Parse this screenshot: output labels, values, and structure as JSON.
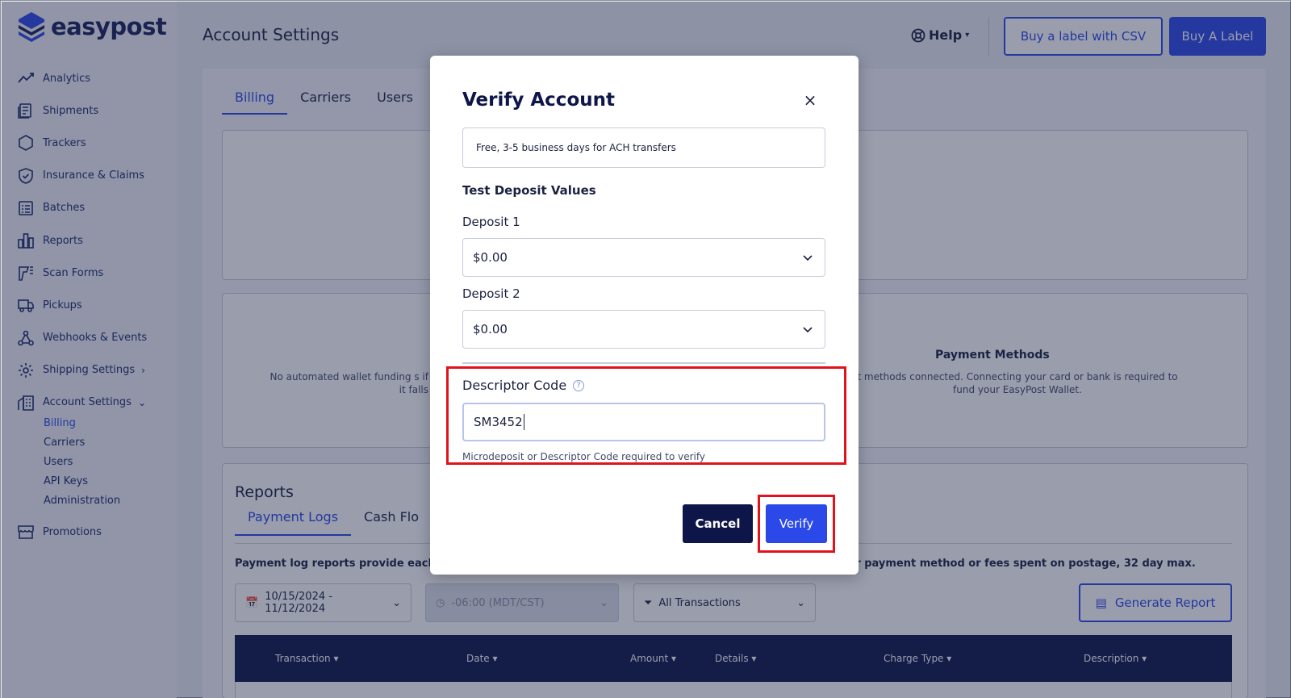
{
  "brand": {
    "name": "easypost",
    "accent": "#2b48e8",
    "navy": "#0d1549",
    "highlight": "#e1121b"
  },
  "sidebar": {
    "items": [
      {
        "label": "Analytics",
        "icon": "analytics-icon"
      },
      {
        "label": "Shipments",
        "icon": "shipments-icon"
      },
      {
        "label": "Trackers",
        "icon": "trackers-icon"
      },
      {
        "label": "Insurance & Claims",
        "icon": "shield-icon"
      },
      {
        "label": "Batches",
        "icon": "batches-icon"
      },
      {
        "label": "Reports",
        "icon": "reports-icon"
      },
      {
        "label": "Scan Forms",
        "icon": "scanner-icon"
      },
      {
        "label": "Pickups",
        "icon": "truck-icon"
      },
      {
        "label": "Webhooks & Events",
        "icon": "webhooks-icon"
      },
      {
        "label": "Shipping Settings",
        "icon": "gear-icon"
      },
      {
        "label": "Account Settings",
        "icon": "account-icon"
      },
      {
        "label": "Promotions",
        "icon": "store-icon"
      }
    ],
    "account_sub": [
      "Billing",
      "Carriers",
      "Users",
      "API Keys",
      "Administration"
    ],
    "shipping_chevron": "›",
    "account_chevron": "⌄"
  },
  "header": {
    "title": "Account Settings",
    "help_label": "Help",
    "buy_csv_label": "Buy a label with CSV",
    "buy_label": "Buy A Label"
  },
  "tabs": [
    "Billing",
    "Carriers",
    "Users"
  ],
  "background": {
    "wallet_text": "No automated wallet funding s if it falls",
    "payment_methods_title": "Payment Methods",
    "payment_methods_text": "t methods connected. Connecting your card or bank is required to fund your EasyPost Wallet.",
    "reports_title": "Reports",
    "report_tabs": [
      "Payment Logs",
      "Cash Flo"
    ],
    "report_desc_left": "Payment log reports provide each i",
    "report_desc_right": "ur payment method or fees spent on postage, 32 day max.",
    "date_range": "10/15/2024 - 11/12/2024",
    "timezone": "-06:00 (MDT/CST)",
    "transactions_filter": "All Transactions",
    "generate_report": "Generate Report",
    "columns": [
      "Transaction",
      "Date",
      "Amount",
      "Details",
      "Charge Type",
      "Description"
    ]
  },
  "modal": {
    "title": "Verify Account",
    "close": "×",
    "info_text": "Free, 3-5 business days for ACH transfers",
    "section_label": "Test Deposit Values",
    "deposit1_label": "Deposit 1",
    "deposit1_value": "$0.00",
    "deposit2_label": "Deposit 2",
    "deposit2_value": "$0.00",
    "descriptor_label": "Descriptor Code",
    "descriptor_help_icon": "?",
    "descriptor_value": "SM3452",
    "descriptor_help": "Microdeposit or Descriptor Code required to verify",
    "cancel_label": "Cancel",
    "verify_label": "Verify"
  }
}
